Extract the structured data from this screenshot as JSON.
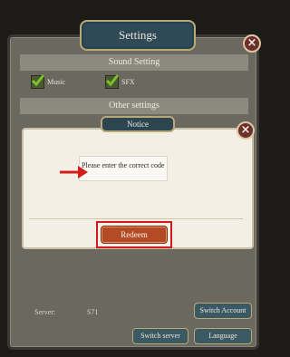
{
  "settings": {
    "title": "Settings",
    "sound_section": "Sound Setting",
    "music_label": "Music",
    "sfx_label": "SFX",
    "other_section": "Other settings",
    "server_label": "Server:",
    "server_value": "S71",
    "switch_account": "Switch Account",
    "switch_server": "Switch server",
    "language": "Language"
  },
  "notice": {
    "title": "Notice",
    "message": "Please enter the correct code",
    "redeem_label": "Redeem"
  },
  "icons": {
    "close": "×"
  },
  "colors": {
    "accent_red": "#d21b1b",
    "dialog_bg": "#f4efe4",
    "title_bg": "#2c4551"
  }
}
